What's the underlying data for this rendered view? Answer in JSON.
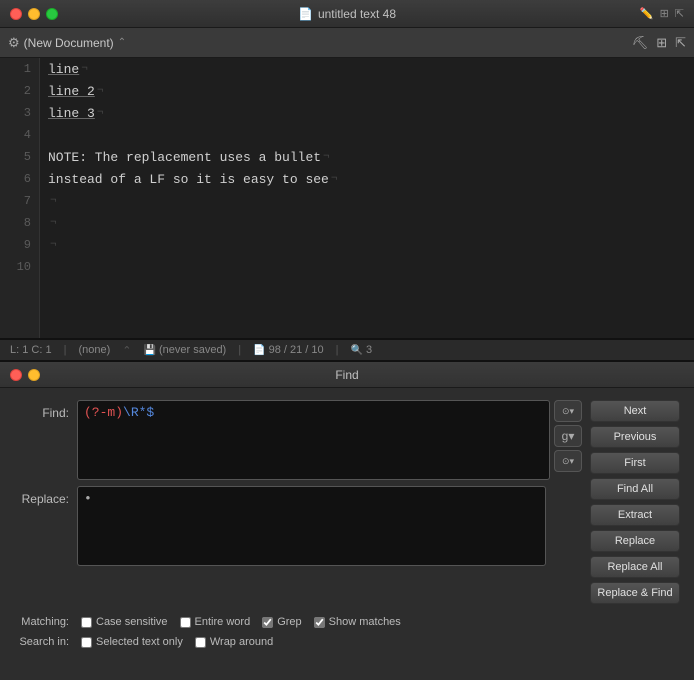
{
  "window": {
    "title": "untitled text 48",
    "toolbar": {
      "doc_name": "(New Document)",
      "chevron": "⌃"
    }
  },
  "editor": {
    "lines": [
      {
        "num": "1",
        "text": "line",
        "pilcrow": "¬",
        "underline": true
      },
      {
        "num": "2",
        "text": "line 2",
        "pilcrow": "¬",
        "underline": true
      },
      {
        "num": "3",
        "text": "line 3",
        "pilcrow": "¬",
        "underline": true
      },
      {
        "num": "4",
        "text": "",
        "pilcrow": ""
      },
      {
        "num": "5",
        "text": "NOTE: The replacement uses a bullet¬",
        "pilcrow": ""
      },
      {
        "num": "6",
        "text": "instead of a LF so it is easy to see¬",
        "pilcrow": ""
      },
      {
        "num": "7",
        "text": "",
        "pilcrow": "¬"
      },
      {
        "num": "8",
        "text": "",
        "pilcrow": "¬"
      },
      {
        "num": "9",
        "text": "",
        "pilcrow": "¬"
      },
      {
        "num": "10",
        "text": "",
        "pilcrow": ""
      }
    ]
  },
  "status_bar": {
    "position": "L: 1 C: 1",
    "syntax": "(none)",
    "saved": "(never saved)",
    "stats": "98 / 21 / 10",
    "zoom": "3"
  },
  "find_panel": {
    "title": "Find",
    "find_label": "Find:",
    "find_value_red": "(?-m)",
    "find_value_blue": "\\R*$",
    "replace_label": "Replace:",
    "replace_value": "•",
    "option_btns": [
      "⊙",
      "g",
      "⊙"
    ],
    "action_buttons": [
      "Next",
      "Previous",
      "First",
      "Find All",
      "Extract",
      "Replace",
      "Replace All",
      "Replace & Find"
    ],
    "matching": {
      "label": "Matching:",
      "options": [
        {
          "id": "case-sensitive",
          "label": "Case sensitive",
          "checked": false
        },
        {
          "id": "entire-word",
          "label": "Entire word",
          "checked": false
        },
        {
          "id": "grep",
          "label": "Grep",
          "checked": true
        },
        {
          "id": "show-matches",
          "label": "Show matches",
          "checked": true
        }
      ]
    },
    "search_in": {
      "label": "Search in:",
      "options": [
        {
          "id": "selected-text",
          "label": "Selected text only",
          "checked": false
        },
        {
          "id": "wrap-around",
          "label": "Wrap around",
          "checked": false
        }
      ]
    }
  },
  "colors": {
    "accent": "#5588dd",
    "btn_bg": "#454545",
    "editor_bg": "#1e1e1e"
  }
}
